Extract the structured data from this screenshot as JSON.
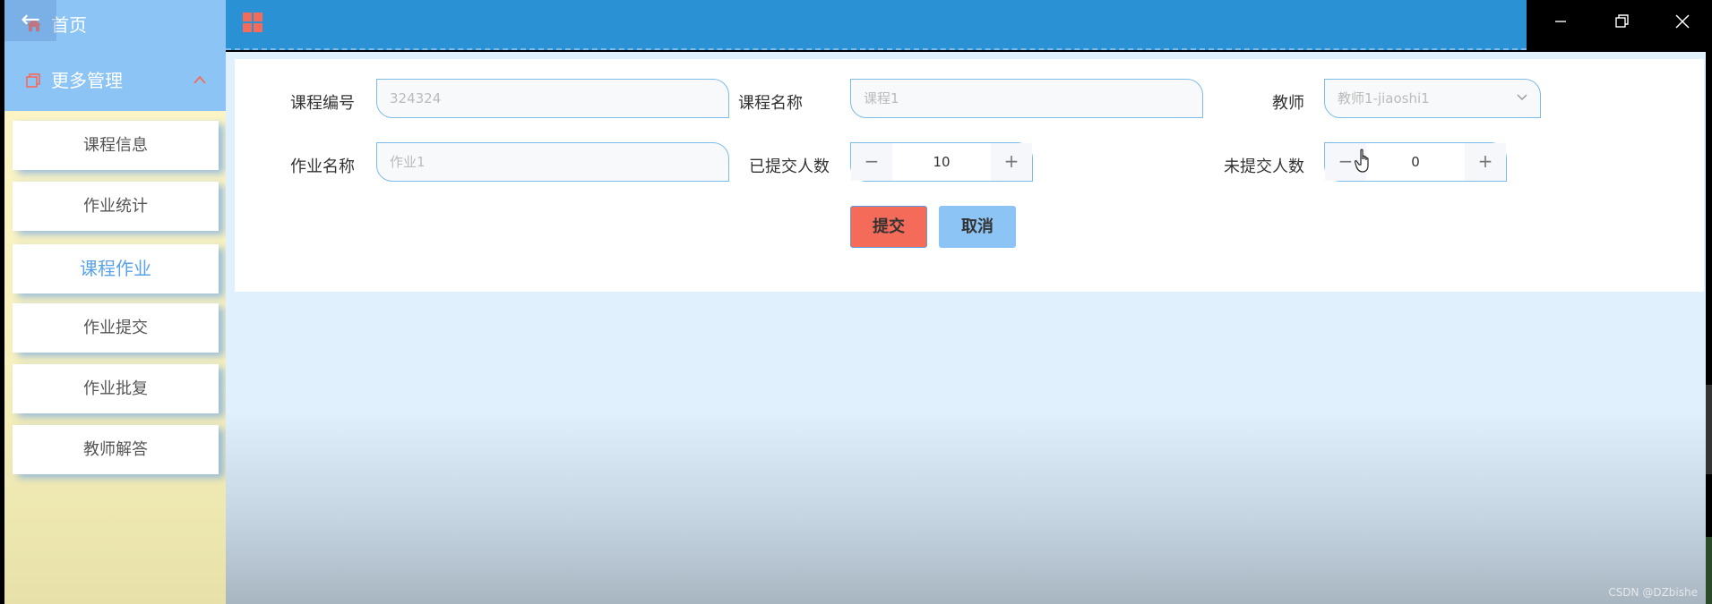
{
  "sidebar": {
    "home_label": "首页",
    "back_glyph": "←",
    "more_label": "更多管理",
    "items": [
      {
        "label": "课程信息",
        "active": false
      },
      {
        "label": "作业统计",
        "active": false
      },
      {
        "label": "课程作业",
        "active": true
      },
      {
        "label": "作业提交",
        "active": false
      },
      {
        "label": "作业批复",
        "active": false
      },
      {
        "label": "教师解答",
        "active": false
      }
    ]
  },
  "form": {
    "course_no": {
      "label": "课程编号",
      "value": "324324"
    },
    "course_name": {
      "label": "课程名称",
      "value": "课程1"
    },
    "teacher": {
      "label": "教师",
      "value": "教师1-jiaoshi1"
    },
    "homework_name": {
      "label": "作业名称",
      "value": "作业1"
    },
    "submitted_count": {
      "label": "已提交人数",
      "value": "10"
    },
    "unsubmitted_count": {
      "label": "未提交人数",
      "value": "0"
    },
    "stepper_minus": "−",
    "stepper_plus": "+"
  },
  "buttons": {
    "submit": "提交",
    "cancel": "取消"
  },
  "watermark": "CSDN @DZbishe",
  "colors": {
    "sidebar_header": "#8cc4f5",
    "topbar": "#2a91d4",
    "active_item": "#5aa3e8",
    "submit_button": "#f56b5a",
    "cancel_button": "#8cc4f5",
    "grid_icon": "#f56b5a"
  }
}
